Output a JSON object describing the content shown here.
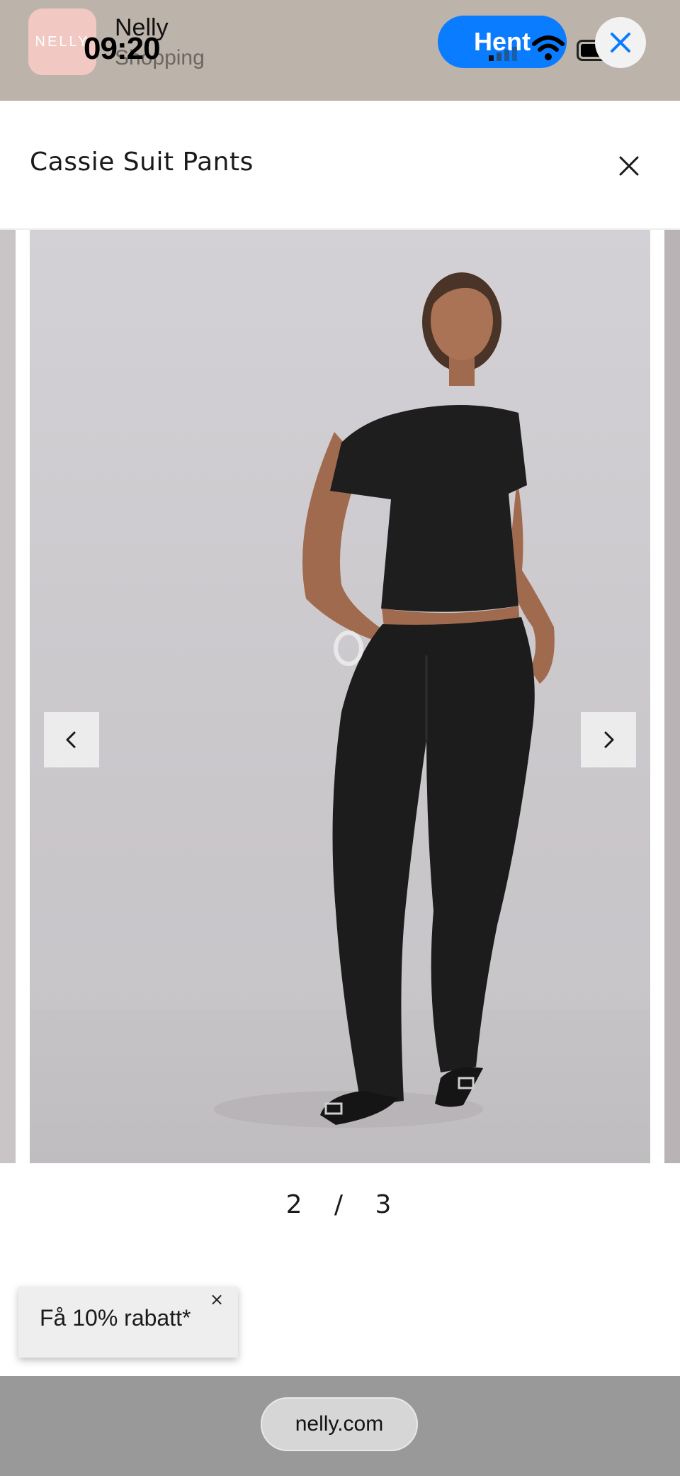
{
  "banner": {
    "app_icon_text": "NELLY",
    "app_name": "Nelly",
    "app_subtitle": "Shopping",
    "time": "09:20",
    "get_button_label": "Hent",
    "icons": [
      "signal-icon",
      "wifi-icon",
      "battery-icon",
      "close-icon"
    ],
    "accent": "#0a7cff"
  },
  "modal": {
    "title": "Cassie Suit Pants",
    "close_icon": "close-icon"
  },
  "gallery": {
    "current": "2",
    "separator": "/",
    "total": "3",
    "prev_icon": "chevron-left-icon",
    "next_icon": "chevron-right-icon"
  },
  "discount": {
    "label": "Få 10% rabatt*",
    "close": "×"
  },
  "browser": {
    "url": "nelly.com"
  }
}
